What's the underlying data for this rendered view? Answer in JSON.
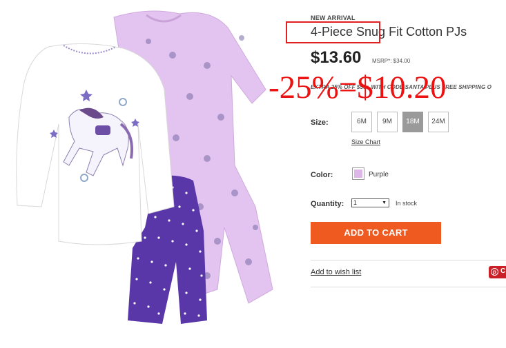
{
  "product": {
    "badge": "NEW ARRIVAL",
    "title": "4-Piece Snug Fit Cotton PJs",
    "price": "$13.60",
    "msrp": "MSRP*: $34.00",
    "promo": "EXTRA 25% OFF $50+ WITH CODE SANTA PLUS FREE SHIPPING O",
    "annotation": "-25%=$10.20",
    "annotation_color": "#ec1212"
  },
  "size": {
    "label": "Size:",
    "options": [
      "6M",
      "9M",
      "18M",
      "24M"
    ],
    "selected": "18M",
    "chart_link": "Size Chart"
  },
  "color": {
    "label": "Color:",
    "value": "Purple",
    "swatch": "#dcb6e6"
  },
  "quantity": {
    "label": "Quantity:",
    "value": "1",
    "stock": "In stock"
  },
  "actions": {
    "add_to_cart": "ADD TO CART",
    "wishlist": "Add to wish list",
    "pin_letter": "p",
    "pin_text": "C",
    "cart_color": "#ee5a1f"
  }
}
